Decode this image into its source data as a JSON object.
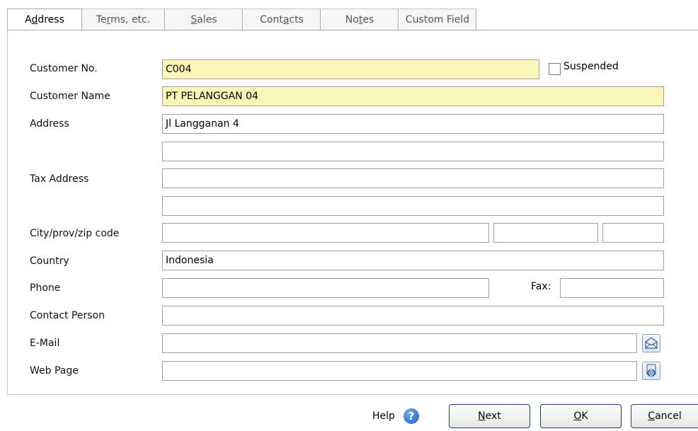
{
  "tabs": [
    {
      "key": "address",
      "pre": "A",
      "mn": "d",
      "post": "dress"
    },
    {
      "key": "terms",
      "pre": "Te",
      "mn": "r",
      "post": "ms, etc."
    },
    {
      "key": "sales",
      "pre": "",
      "mn": "S",
      "post": "ales"
    },
    {
      "key": "contacts",
      "pre": "Cont",
      "mn": "a",
      "post": "cts"
    },
    {
      "key": "notes",
      "pre": "No",
      "mn": "t",
      "post": "es"
    },
    {
      "key": "custom",
      "pre": "Custom Field",
      "mn": "",
      "post": ""
    }
  ],
  "form": {
    "customer_no_label": "Customer No.",
    "customer_no_value": "C004",
    "suspended_label": "Suspended",
    "customer_name_label": "Customer Name",
    "customer_name_value": "PT PELANGGAN 04",
    "address_label": "Address",
    "address_line1": "Jl Langganan 4",
    "address_line2": "",
    "tax_address_label": "Tax Address",
    "tax_address_line1": "",
    "tax_address_line2": "",
    "city_label": "City/prov/zip code",
    "city_value": "",
    "prov_value": "",
    "zip_value": "",
    "country_label": "Country",
    "country_value": "Indonesia",
    "phone_label": "Phone",
    "phone_value": "",
    "fax_label": "Fax:",
    "fax_value": "",
    "contact_label": "Contact Person",
    "contact_value": "",
    "email_label": "E-Mail",
    "email_value": "",
    "web_label": "Web Page",
    "web_value": ""
  },
  "footer": {
    "help_label": "Help",
    "next": {
      "mn": "N",
      "rest": "ext"
    },
    "ok": {
      "mn": "O",
      "rest": "K"
    },
    "cancel": {
      "mn": "C",
      "rest": "ancel"
    }
  },
  "icons": {
    "email": "envelope-icon",
    "web": "globe-icon",
    "help": "help-icon"
  },
  "colors": {
    "required_field": "#fbf6b8",
    "button_border": "#1e3f7a"
  }
}
